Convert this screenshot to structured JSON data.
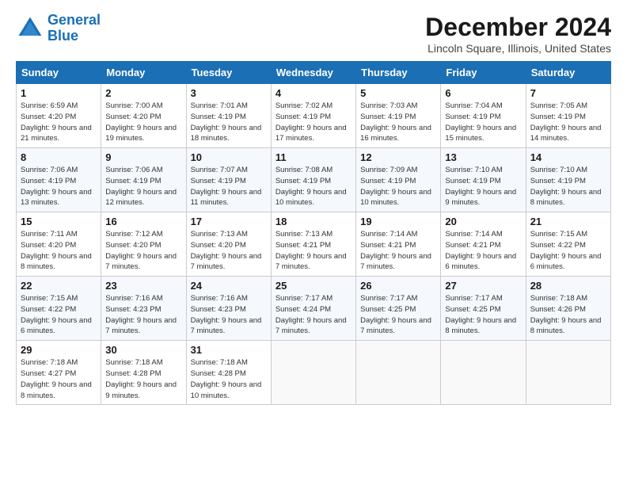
{
  "logo": {
    "line1": "General",
    "line2": "Blue"
  },
  "title": "December 2024",
  "location": "Lincoln Square, Illinois, United States",
  "days_of_week": [
    "Sunday",
    "Monday",
    "Tuesday",
    "Wednesday",
    "Thursday",
    "Friday",
    "Saturday"
  ],
  "weeks": [
    [
      {
        "day": "1",
        "sunrise": "Sunrise: 6:59 AM",
        "sunset": "Sunset: 4:20 PM",
        "daylight": "Daylight: 9 hours and 21 minutes."
      },
      {
        "day": "2",
        "sunrise": "Sunrise: 7:00 AM",
        "sunset": "Sunset: 4:20 PM",
        "daylight": "Daylight: 9 hours and 19 minutes."
      },
      {
        "day": "3",
        "sunrise": "Sunrise: 7:01 AM",
        "sunset": "Sunset: 4:19 PM",
        "daylight": "Daylight: 9 hours and 18 minutes."
      },
      {
        "day": "4",
        "sunrise": "Sunrise: 7:02 AM",
        "sunset": "Sunset: 4:19 PM",
        "daylight": "Daylight: 9 hours and 17 minutes."
      },
      {
        "day": "5",
        "sunrise": "Sunrise: 7:03 AM",
        "sunset": "Sunset: 4:19 PM",
        "daylight": "Daylight: 9 hours and 16 minutes."
      },
      {
        "day": "6",
        "sunrise": "Sunrise: 7:04 AM",
        "sunset": "Sunset: 4:19 PM",
        "daylight": "Daylight: 9 hours and 15 minutes."
      },
      {
        "day": "7",
        "sunrise": "Sunrise: 7:05 AM",
        "sunset": "Sunset: 4:19 PM",
        "daylight": "Daylight: 9 hours and 14 minutes."
      }
    ],
    [
      {
        "day": "8",
        "sunrise": "Sunrise: 7:06 AM",
        "sunset": "Sunset: 4:19 PM",
        "daylight": "Daylight: 9 hours and 13 minutes."
      },
      {
        "day": "9",
        "sunrise": "Sunrise: 7:06 AM",
        "sunset": "Sunset: 4:19 PM",
        "daylight": "Daylight: 9 hours and 12 minutes."
      },
      {
        "day": "10",
        "sunrise": "Sunrise: 7:07 AM",
        "sunset": "Sunset: 4:19 PM",
        "daylight": "Daylight: 9 hours and 11 minutes."
      },
      {
        "day": "11",
        "sunrise": "Sunrise: 7:08 AM",
        "sunset": "Sunset: 4:19 PM",
        "daylight": "Daylight: 9 hours and 10 minutes."
      },
      {
        "day": "12",
        "sunrise": "Sunrise: 7:09 AM",
        "sunset": "Sunset: 4:19 PM",
        "daylight": "Daylight: 9 hours and 10 minutes."
      },
      {
        "day": "13",
        "sunrise": "Sunrise: 7:10 AM",
        "sunset": "Sunset: 4:19 PM",
        "daylight": "Daylight: 9 hours and 9 minutes."
      },
      {
        "day": "14",
        "sunrise": "Sunrise: 7:10 AM",
        "sunset": "Sunset: 4:19 PM",
        "daylight": "Daylight: 9 hours and 8 minutes."
      }
    ],
    [
      {
        "day": "15",
        "sunrise": "Sunrise: 7:11 AM",
        "sunset": "Sunset: 4:20 PM",
        "daylight": "Daylight: 9 hours and 8 minutes."
      },
      {
        "day": "16",
        "sunrise": "Sunrise: 7:12 AM",
        "sunset": "Sunset: 4:20 PM",
        "daylight": "Daylight: 9 hours and 7 minutes."
      },
      {
        "day": "17",
        "sunrise": "Sunrise: 7:13 AM",
        "sunset": "Sunset: 4:20 PM",
        "daylight": "Daylight: 9 hours and 7 minutes."
      },
      {
        "day": "18",
        "sunrise": "Sunrise: 7:13 AM",
        "sunset": "Sunset: 4:21 PM",
        "daylight": "Daylight: 9 hours and 7 minutes."
      },
      {
        "day": "19",
        "sunrise": "Sunrise: 7:14 AM",
        "sunset": "Sunset: 4:21 PM",
        "daylight": "Daylight: 9 hours and 7 minutes."
      },
      {
        "day": "20",
        "sunrise": "Sunrise: 7:14 AM",
        "sunset": "Sunset: 4:21 PM",
        "daylight": "Daylight: 9 hours and 6 minutes."
      },
      {
        "day": "21",
        "sunrise": "Sunrise: 7:15 AM",
        "sunset": "Sunset: 4:22 PM",
        "daylight": "Daylight: 9 hours and 6 minutes."
      }
    ],
    [
      {
        "day": "22",
        "sunrise": "Sunrise: 7:15 AM",
        "sunset": "Sunset: 4:22 PM",
        "daylight": "Daylight: 9 hours and 6 minutes."
      },
      {
        "day": "23",
        "sunrise": "Sunrise: 7:16 AM",
        "sunset": "Sunset: 4:23 PM",
        "daylight": "Daylight: 9 hours and 7 minutes."
      },
      {
        "day": "24",
        "sunrise": "Sunrise: 7:16 AM",
        "sunset": "Sunset: 4:23 PM",
        "daylight": "Daylight: 9 hours and 7 minutes."
      },
      {
        "day": "25",
        "sunrise": "Sunrise: 7:17 AM",
        "sunset": "Sunset: 4:24 PM",
        "daylight": "Daylight: 9 hours and 7 minutes."
      },
      {
        "day": "26",
        "sunrise": "Sunrise: 7:17 AM",
        "sunset": "Sunset: 4:25 PM",
        "daylight": "Daylight: 9 hours and 7 minutes."
      },
      {
        "day": "27",
        "sunrise": "Sunrise: 7:17 AM",
        "sunset": "Sunset: 4:25 PM",
        "daylight": "Daylight: 9 hours and 8 minutes."
      },
      {
        "day": "28",
        "sunrise": "Sunrise: 7:18 AM",
        "sunset": "Sunset: 4:26 PM",
        "daylight": "Daylight: 9 hours and 8 minutes."
      }
    ],
    [
      {
        "day": "29",
        "sunrise": "Sunrise: 7:18 AM",
        "sunset": "Sunset: 4:27 PM",
        "daylight": "Daylight: 9 hours and 8 minutes."
      },
      {
        "day": "30",
        "sunrise": "Sunrise: 7:18 AM",
        "sunset": "Sunset: 4:28 PM",
        "daylight": "Daylight: 9 hours and 9 minutes."
      },
      {
        "day": "31",
        "sunrise": "Sunrise: 7:18 AM",
        "sunset": "Sunset: 4:28 PM",
        "daylight": "Daylight: 9 hours and 10 minutes."
      },
      null,
      null,
      null,
      null
    ]
  ]
}
